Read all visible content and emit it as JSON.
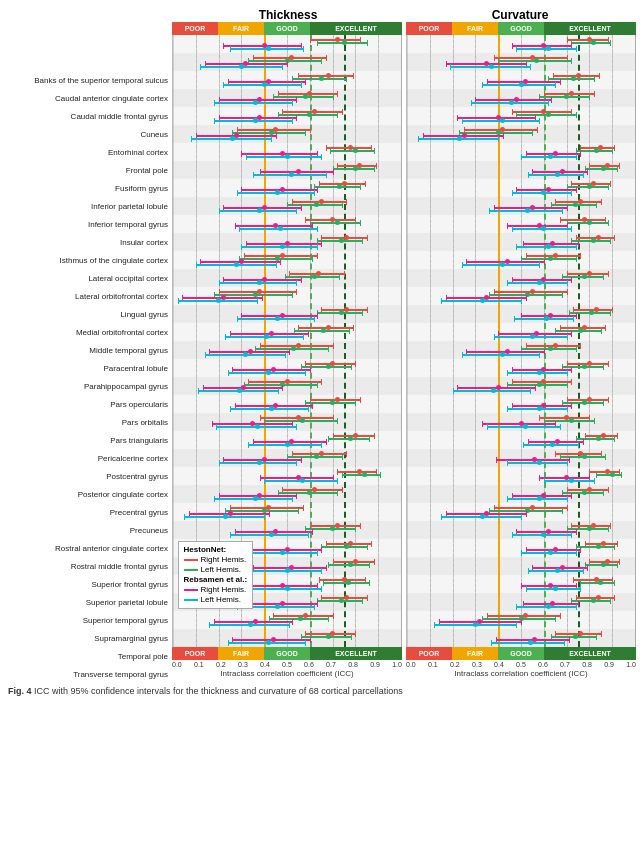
{
  "titles": {
    "thickness": "Thickness",
    "curvature": "Curvature",
    "x_axis_label": "Intraclass correlation coefficient (ICC)",
    "fig_caption": "Fig. 4 ICC with 95% confidence intervals for the thickness and curvature of 68 cortical parcellations"
  },
  "quality_labels": {
    "poor": "POOR",
    "fair": "FAIR",
    "good": "GOOD",
    "excellent": "EXCELLENT"
  },
  "x_ticks": [
    "0.0",
    "0.1",
    "0.2",
    "0.3",
    "0.4",
    "0.5",
    "0.6",
    "0.7",
    "0.8",
    "0.9",
    "1.0"
  ],
  "regions": [
    "Banks of the superior temporal sulcus",
    "Caudal anterior cingulate cortex",
    "Caudal middle frontal gyrus",
    "Cuneus",
    "Entorhinal cortex",
    "Frontal pole",
    "Fusiform gyrus",
    "Inferior parietal lobule",
    "Inferior temporal gyrus",
    "Insular cortex",
    "Isthmus of the cingulate cortex",
    "Lateral occipital cortex",
    "Lateral orbitofrontal cortex",
    "Lingual gyrus",
    "Medial orbitofrontal cortex",
    "Middle temporal gyrus",
    "Paracentral lobule",
    "Parahippocampal gyrus",
    "Pars opercularis",
    "Pars orbitalis",
    "Pars triangularis",
    "Pericalcerine cortex",
    "Postcentral gyrus",
    "Posterior cingulate cortex",
    "Precentral gyrus",
    "Precuneus",
    "Rostral anterior cingulate cortex",
    "Rostral middle frontal gyrus",
    "Superior frontal gyrus",
    "Superior parietal lobule",
    "Superior temporal gyrus",
    "Supramarginal gyrus",
    "Temporal pole",
    "Transverse temporal gyrus"
  ],
  "legend": {
    "title1": "HestonNet:",
    "right_hemis_1": "Right Hemis.",
    "left_hemis_1": "Left Hemis.",
    "title2": "Rebsamen et al.:",
    "right_hemis_2": "Right Hemis.",
    "left_hemis_2": "Left Hemis.",
    "colors": {
      "heston_right": "#e74c3c",
      "heston_left": "#27ae60",
      "rebsamen_right": "#e91e8c",
      "rebsamen_left": "#00bcd4"
    }
  }
}
